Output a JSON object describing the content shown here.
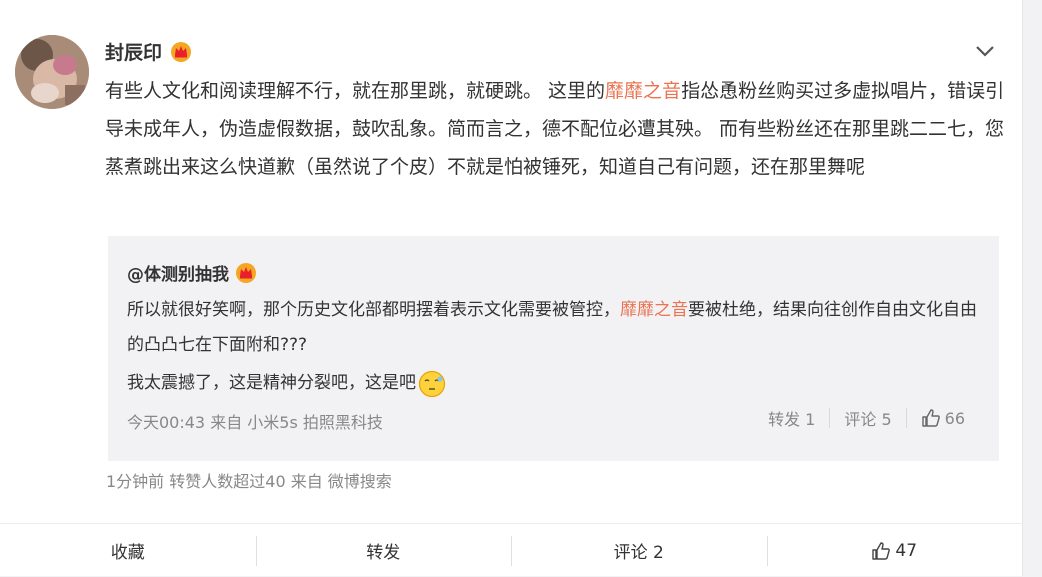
{
  "post": {
    "author": "封辰印",
    "text_parts": [
      "有些人文化和阅读理解不行，就在那里跳，就硬跳。 这里的",
      "靡靡之音",
      "指怂恿粉丝购买过多虚拟唱片，错误引导未成年人，伪造虚假数据，鼓吹乱象。简而言之，德不配位必遭其殃。 而有些粉丝还在那里跳二二七，您蒸煮跳出来这么快道歉（虽然说了个皮）不就是怕被锤死，知道自己有问题，还在那里舞呢"
    ],
    "meta": "1分钟前 转赞人数超过40  来自 微博搜索"
  },
  "quote": {
    "author": "@体测别抽我",
    "text_part1": "所以就很好笑啊，那个历史文化部都明摆着表示文化需要被管控，",
    "text_highlight": "靡靡之音",
    "text_part2": "要被杜绝，结果向往创作自由文化自由的凸凸七在下面附和???",
    "text_line3": "我太震撼了，这是精神分裂吧，这是吧",
    "meta": "今天00:43 来自 小米5s 拍照黑科技",
    "repost": "转发 1",
    "comment": "评论 5",
    "likes": "66"
  },
  "actions": {
    "favorite": "收藏",
    "repost": "转发",
    "comment": "评论 2",
    "likes": "47"
  },
  "icons": {
    "crown": "crown-badge-icon",
    "menu": "chevron-down-icon",
    "like": "thumbs-up-icon",
    "emoji": "awkward-emoji-icon"
  },
  "colors": {
    "highlight": "#eb7350",
    "meta": "#888888",
    "quote_bg": "#f2f2f5"
  }
}
